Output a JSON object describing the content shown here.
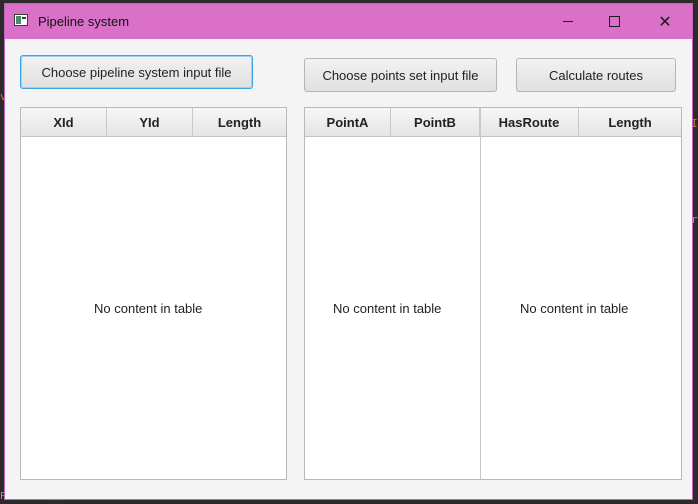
{
  "window": {
    "title": "Pipeline system",
    "controls": {
      "minimize_icon": "minimize-icon",
      "maximize_icon": "maximize-icon",
      "close_icon": "close-icon",
      "close_glyph": "✕"
    },
    "titlebar_color": "#db70c8"
  },
  "toolbar": {
    "choose_pipeline_label": "Choose pipeline system input file",
    "choose_points_label": "Choose points set input file",
    "calculate_label": "Calculate routes"
  },
  "pipeline_table": {
    "columns": [
      "XId",
      "YId",
      "Length"
    ],
    "empty_text": "No content in table"
  },
  "points_table": {
    "columns": [
      "PointA",
      "PointB",
      "HasRoute",
      "Length"
    ],
    "empty_text_left": "No content in table",
    "empty_text_right": "No content in table"
  }
}
